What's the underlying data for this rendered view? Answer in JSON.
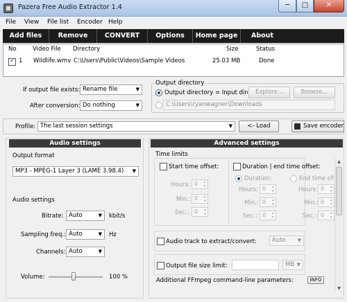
{
  "window": {
    "title": "Pazera Free Audio Extractor 1.4",
    "min": "─",
    "max": "□",
    "close": "✕"
  },
  "menu": [
    "File",
    "View",
    "File list",
    "Encoder",
    "Help"
  ],
  "toolbar": [
    "Add files",
    "Remove",
    "CONVERT",
    "Options",
    "Home page",
    "About"
  ],
  "filelist": {
    "headers": {
      "no": "No",
      "video": "Video File",
      "dir": "Directory",
      "size": "Size",
      "status": "Status"
    },
    "rows": [
      {
        "checked": true,
        "no": "1",
        "video": "Wildlife.wmv",
        "dir": "C:\\Users\\Public\\Videos\\Sample Videos",
        "size": "25.03 MB",
        "status": "Done"
      }
    ]
  },
  "options": {
    "exists_label": "If output file exists:",
    "exists_value": "Rename file",
    "after_label": "After conversion:",
    "after_value": "Do nothing"
  },
  "output_dir": {
    "title": "Output directory",
    "opt1": "Output directory = Input directory",
    "explore": "Explore...",
    "browse": "Browse...",
    "path": "C:\\Users\\ryanwagner\\Downloads"
  },
  "profile": {
    "label": "Profile:",
    "value": "The last session settings",
    "load": "<- Load",
    "save": "Save encoder"
  },
  "audio": {
    "head": "Audio settings",
    "format_title": "Output format",
    "format_value": "MP3 - MPEG-1 Layer 3 (LAME 3.98.4)",
    "settings_title": "Audio settings",
    "bitrate_label": "Bitrate:",
    "bitrate_value": "Auto",
    "bitrate_unit": "kbit/s",
    "freq_label": "Sampling freq.:",
    "freq_value": "Auto",
    "freq_unit": "Hz",
    "channels_label": "Channels:",
    "channels_value": "Auto",
    "volume_label": "Volume:",
    "volume_value": "100 %",
    "volume_level": 0.5
  },
  "advanced": {
    "head": "Advanced settings",
    "limits_title": "Time limits",
    "start_label": "Start time offset:",
    "duration_label": "Duration | end time offset:",
    "hours": "Hours:",
    "min": "Min.:",
    "sec": "Sec.:",
    "zero": "0",
    "duration_radio": "Duration:",
    "end_radio": "End time off",
    "track_label": "Audio track to extract/convert:",
    "track_value": "Auto",
    "size_label": "Output file size limit:",
    "size_unit": "MB",
    "ffmpeg_label": "Additional FFmpeg command-line parameters:",
    "info": "INFO"
  }
}
